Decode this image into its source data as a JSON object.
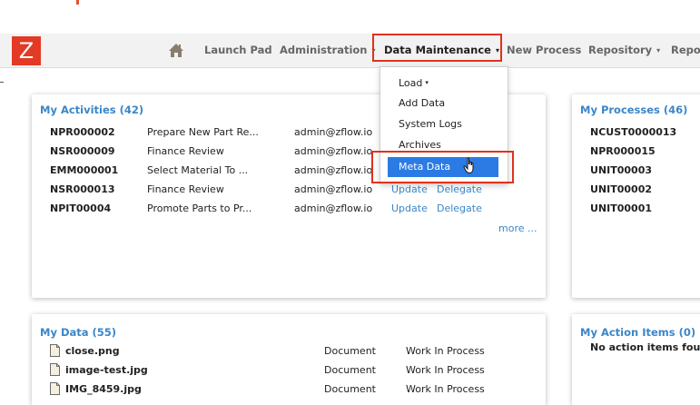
{
  "brand": {
    "logo_letter": "Z"
  },
  "nav": {
    "items": [
      {
        "label": "Launch Pad",
        "caret": ""
      },
      {
        "label": "Administration",
        "caret": "▾"
      },
      {
        "label": "Data Maintenance",
        "caret": "▾"
      },
      {
        "label": "New Process",
        "caret": ""
      },
      {
        "label": "Repository",
        "caret": "▾"
      },
      {
        "label": "Repo",
        "caret": ""
      }
    ]
  },
  "dropdown": {
    "items": [
      {
        "label": "Load",
        "caret": "▾"
      },
      {
        "label": "Add Data",
        "caret": ""
      },
      {
        "label": "System Logs",
        "caret": ""
      },
      {
        "label": "Archives",
        "caret": ""
      },
      {
        "label": "Meta Data",
        "caret": ""
      }
    ]
  },
  "activities": {
    "title": "My Activities (42)",
    "rows": [
      {
        "id": "NPR000002",
        "task": "Prepare New Part Re...",
        "user": "admin@zflow.io",
        "update": "",
        "delegate": ""
      },
      {
        "id": "NSR000009",
        "task": "Finance Review",
        "user": "admin@zflow.io",
        "update": "",
        "delegate": ""
      },
      {
        "id": "EMM000001",
        "task": "Select Material To ...",
        "user": "admin@zflow.io",
        "update": "",
        "delegate": ""
      },
      {
        "id": "NSR000013",
        "task": "Finance Review",
        "user": "admin@zflow.io",
        "update": "Update",
        "delegate": "Delegate"
      },
      {
        "id": "NPIT00004",
        "task": "Promote Parts to Pr...",
        "user": "admin@zflow.io",
        "update": "Update",
        "delegate": "Delegate"
      }
    ],
    "more": "more ..."
  },
  "processes": {
    "title": "My Processes (46)",
    "rows": [
      "NCUST0000013",
      "NPR000015",
      "UNIT00003",
      "UNIT00002",
      "UNIT00001"
    ]
  },
  "mydata": {
    "title": "My Data (55)",
    "rows": [
      {
        "name": "close.png",
        "type": "Document",
        "status": "Work In Process"
      },
      {
        "name": "image-test.jpg",
        "type": "Document",
        "status": "Work In Process"
      },
      {
        "name": "IMG_8459.jpg",
        "type": "Document",
        "status": "Work In Process"
      }
    ]
  },
  "actions": {
    "title": "My Action Items (0)",
    "empty": "No action items fou"
  },
  "colors": {
    "accent": "#3a86c8",
    "brand": "#e23a24",
    "highlight": "#e0321c",
    "selected": "#2c7be5"
  }
}
